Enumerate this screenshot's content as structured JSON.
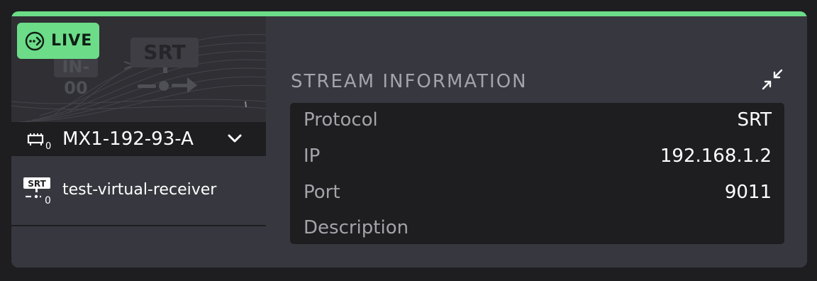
{
  "status": {
    "live_label": "LIVE"
  },
  "thumbnail": {
    "input_label": "IN-00",
    "protocol_label": "SRT",
    "arrow": ">"
  },
  "device": {
    "name": "MX1-192-93-A",
    "count": "0"
  },
  "receiver": {
    "name": "test-virtual-receiver",
    "icon_label": "SRT",
    "count": "0"
  },
  "stream_info": {
    "title": "STREAM INFORMATION",
    "rows": [
      {
        "key": "Protocol",
        "value": "SRT"
      },
      {
        "key": "IP",
        "value": "192.168.1.2"
      },
      {
        "key": "Port",
        "value": "9011"
      },
      {
        "key": "Description",
        "value": ""
      }
    ]
  },
  "colors": {
    "accent_green": "#6cdc88",
    "card_bg": "#37373f",
    "panel_bg": "#1e1e21",
    "muted_text": "#a3a3a9"
  },
  "icons": {
    "live": "live-stream-icon",
    "device": "device-icon",
    "chevron": "chevron-down-icon",
    "receiver": "srt-receiver-icon",
    "collapse": "collapse-icon"
  }
}
